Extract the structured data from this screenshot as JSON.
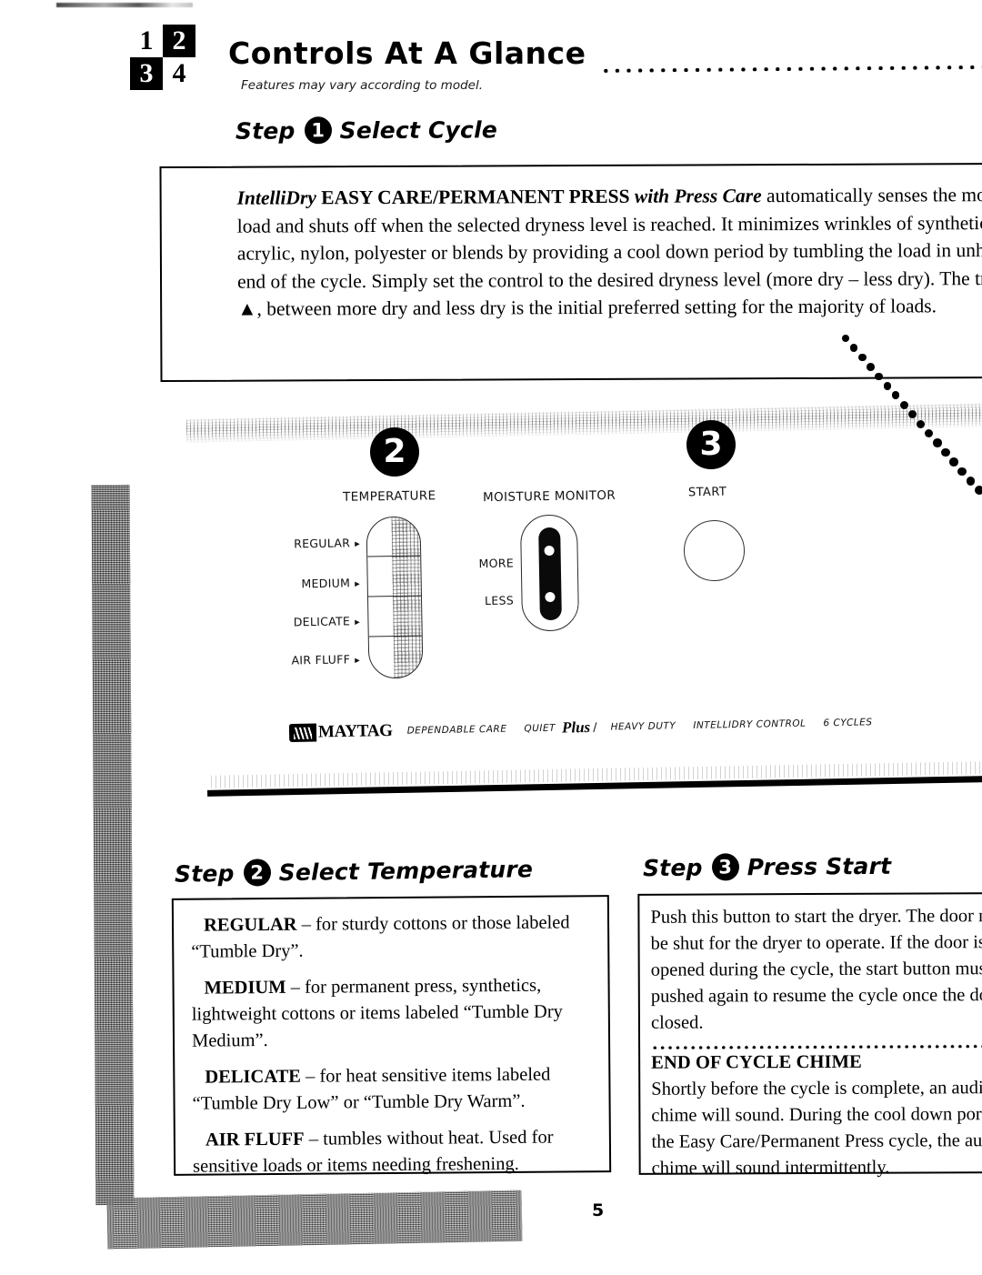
{
  "header": {
    "logo_digits": [
      "1",
      "2",
      "3",
      "4"
    ],
    "title": "Controls At A Glance",
    "leader_icon": "dotted-leader",
    "subtitle": "Features may vary according to model."
  },
  "step1": {
    "step_word": "Step",
    "badge": "1",
    "title": "Select Cycle",
    "body_lead_italic": "IntelliDry",
    "body_lead_bold": "EASY CARE/PERMANENT PRESS",
    "body_lead_bolditalic": "with Press Care",
    "body_rest": "automatically senses the moisture in the load and shuts off when the selected dryness level is reached. It minimizes wrinkles of synthetic fabrics such as acrylic, nylon, polyester or blends by providing a cool down period by tumbling the load in unheated air at the end of the cycle. Simply set the control to the desired dryness level (more dry – less dry). The triangle symbol, ▲, between more dry and less dry is the initial preferred setting for the majority of loads."
  },
  "panel": {
    "badge_2": "2",
    "badge_3": "3",
    "temperature": {
      "label": "TEMPERATURE",
      "options": [
        "REGULAR",
        "MEDIUM",
        "DELICATE",
        "AIR FLUFF"
      ]
    },
    "moisture": {
      "label": "MOISTURE MONITOR",
      "options": [
        "MORE",
        "LESS"
      ]
    },
    "start": {
      "label": "START",
      "button_icon": "round-push-button"
    },
    "brand": {
      "mark_icon": "maytag-bars-logo",
      "name": "MAYTAG",
      "items": [
        "DEPENDABLE CARE",
        "QUIET",
        "HEAVY DUTY",
        "INTELLIDRY CONTROL",
        "6 CYCLES"
      ],
      "plus_script": "Plus",
      "separator": "/"
    }
  },
  "step2": {
    "step_word": "Step",
    "badge": "2",
    "title": "Select Temperature",
    "items": [
      {
        "lead": "REGULAR",
        "text": " – for sturdy cottons or those labeled “Tumble Dry”."
      },
      {
        "lead": "MEDIUM",
        "text": " – for permanent press, synthetics, lightweight cottons or items labeled “Tumble Dry Medium”."
      },
      {
        "lead": "DELICATE",
        "text": " – for heat sensitive items labeled “Tumble Dry Low” or “Tumble Dry Warm”."
      },
      {
        "lead": "AIR FLUFF",
        "text": " – tumbles without heat. Used for sensitive loads or items needing freshening."
      }
    ]
  },
  "step3": {
    "step_word": "Step",
    "badge": "3",
    "title": "Press Start",
    "body": "Push this button to start the dryer. The door must be shut for the dryer to operate. If the door is opened during the cycle, the start button must be pushed again to resume the cycle once the door is closed.",
    "chime_title": "END OF CYCLE CHIME",
    "chime_body": "Shortly before the cycle is complete, an audible chime will sound. During the cool down portion of the Easy Care/Permanent Press cycle, the audible chime will sound intermittently."
  },
  "footer": {
    "page_number": "5"
  },
  "colors": {
    "ink": "#000000",
    "paper": "#ffffff",
    "shadow": "#8d8d8d"
  }
}
